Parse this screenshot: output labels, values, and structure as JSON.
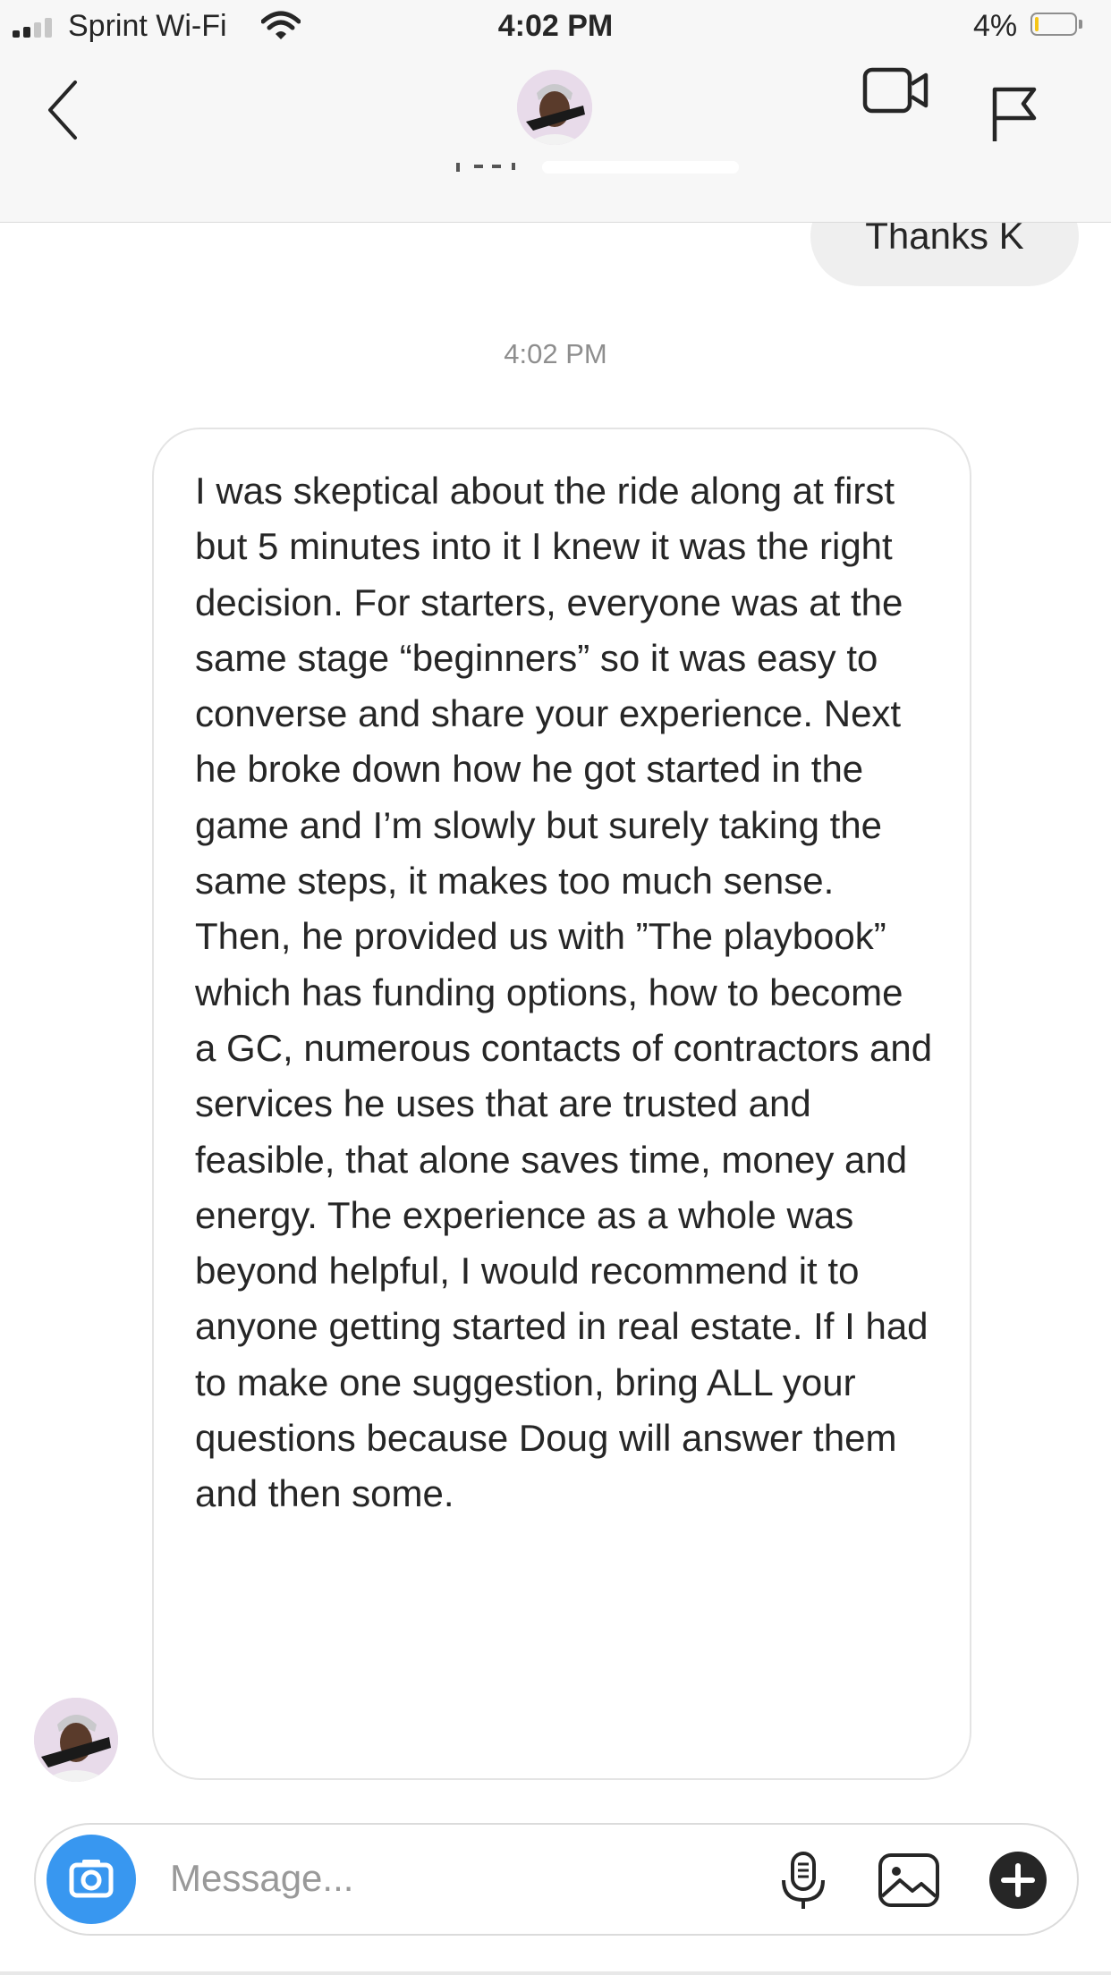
{
  "status_bar": {
    "carrier": "Sprint Wi-Fi",
    "time": "4:02 PM",
    "battery_percent": "4%",
    "battery_level": 0.04,
    "signal_bars": 2,
    "signal_bars_total": 4
  },
  "header": {
    "back_icon": "chevron-left-icon",
    "video_icon": "video-camera-icon",
    "flag_icon": "flag-icon"
  },
  "thread": {
    "outgoing_message": "Thanks K",
    "timestamp": "4:02 PM",
    "incoming_message": "I was skeptical about the ride along at first but 5 minutes into it I knew it was the right decision. For starters, everyone was at the same stage “beginners” so it was easy to converse and share your experience. Next he broke down how he got started in the game and I’m slowly but surely taking the same steps, it makes too much sense. Then, he provided us with ”The playbook” which has funding options, how to become a GC, numerous contacts of contractors and services he uses that are trusted and feasible, that alone saves time, money and energy. The experience as a whole was beyond helpful, I would recommend it to anyone getting started in real estate. If I had to make one suggestion, bring ALL your questions because Doug will answer them and then some."
  },
  "composer": {
    "placeholder": "Message...",
    "value": "",
    "camera_icon": "camera-icon",
    "mic_icon": "microphone-icon",
    "gallery_icon": "gallery-icon",
    "plus_icon": "plus-icon"
  },
  "colors": {
    "accent_blue": "#3897f0",
    "battery_low": "#f5c518",
    "outgoing_bubble": "#efefef",
    "incoming_border": "#e4e4e4",
    "text": "#262626",
    "timestamp": "#8e8e8e"
  }
}
